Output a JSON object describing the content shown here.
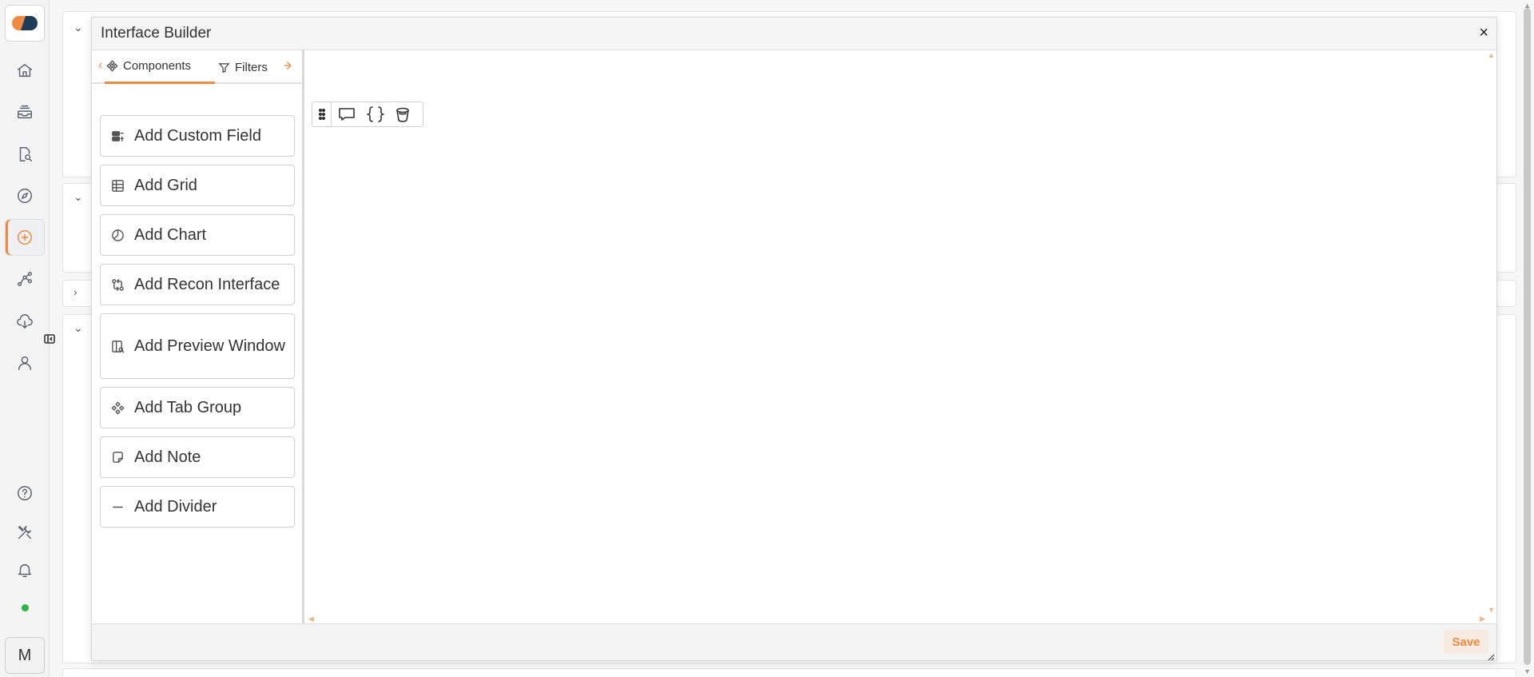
{
  "modal": {
    "title": "Interface Builder",
    "close_label": "×",
    "tabs": [
      {
        "label": "Components",
        "icon": "components-icon"
      },
      {
        "label": "Filters",
        "icon": "filter-icon"
      }
    ],
    "components": [
      {
        "label": "Add Custom Field",
        "icon": "custom-field-icon"
      },
      {
        "label": "Add Grid",
        "icon": "grid-icon"
      },
      {
        "label": "Add Chart",
        "icon": "chart-icon"
      },
      {
        "label": "Add Recon Interface",
        "icon": "recon-icon"
      },
      {
        "label": "Add Preview Window",
        "icon": "preview-window-icon"
      },
      {
        "label": "Add Tab Group",
        "icon": "tab-group-icon"
      },
      {
        "label": "Add Note",
        "icon": "note-icon"
      },
      {
        "label": "Add Divider",
        "icon": "divider-icon"
      }
    ],
    "canvas_toolbar": [
      "drag-handle-icon",
      "comment-icon",
      "code-braces-icon",
      "delete-icon"
    ],
    "save_label": "Save"
  },
  "sidebar": {
    "items": [
      "home-icon",
      "inbox-icon",
      "file-search-icon",
      "compass-icon",
      "add-circle-icon",
      "workflow-icon",
      "cloud-download-icon",
      "user-icon",
      "help-icon",
      "tools-icon",
      "bell-icon"
    ],
    "active_index": 4,
    "avatar_initial": "M",
    "status": "online"
  },
  "colors": {
    "accent": "#f08a3e",
    "status_online": "#2fb344"
  }
}
